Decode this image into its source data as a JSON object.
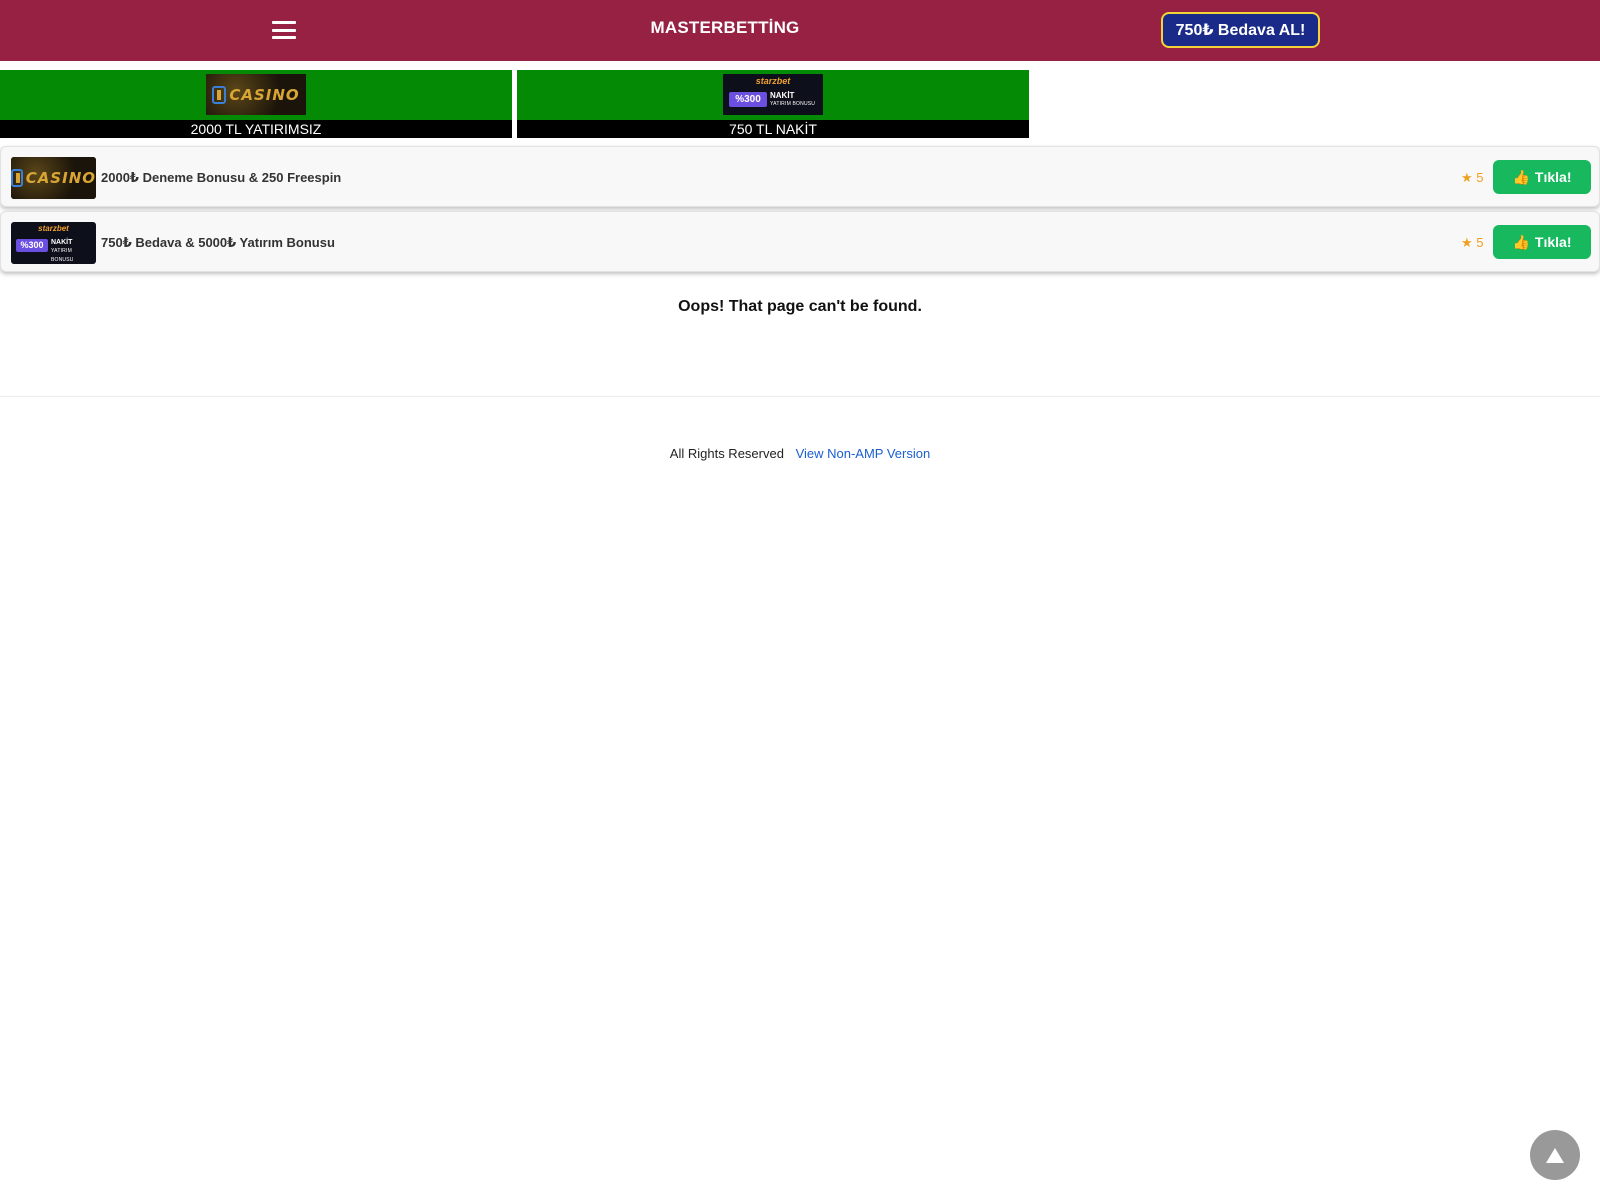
{
  "header": {
    "site_title": "MASTERBETTİNG",
    "cta_label": "750₺ Bedava AL!",
    "menu_icon": "hamburger-menu-icon"
  },
  "banners": [
    {
      "logo": "casino-logo",
      "logo_text": "CASINO",
      "caption": "2000 TL YATIRIMSIZ"
    },
    {
      "logo": "starzbet-logo",
      "logo_brand": "starzbet",
      "logo_percent": "%300",
      "logo_line1": "NAKİT",
      "logo_line2": "YATIRIM BONUSU",
      "caption": "750 TL NAKİT"
    }
  ],
  "offers": [
    {
      "logo": "casino-logo",
      "logo_text": "CASINO",
      "title": "2000₺ Deneme Bonusu & 250 Freespin",
      "rating": "★ 5",
      "button_label": "Tıkla!",
      "button_icon": "thumbs-up-icon"
    },
    {
      "logo": "starzbet-logo",
      "logo_brand": "starzbet",
      "logo_percent": "%300",
      "logo_line1": "NAKİT",
      "logo_line2": "YATIRIM BONUSU",
      "title": "750₺ Bedava & 5000₺ Yatırım Bonusu",
      "rating": "★ 5",
      "button_label": "Tıkla!",
      "button_icon": "thumbs-up-icon"
    }
  ],
  "main": {
    "message": "Oops! That page can't be found."
  },
  "footer": {
    "rights": "All Rights Reserved",
    "link_label": "View Non-AMP Version"
  },
  "colors": {
    "header_bg": "#962142",
    "cta_bg": "#1a2a88",
    "cta_border": "#f3d33a",
    "banner_bg": "#058a05",
    "button_green": "#17b85e",
    "rating": "#f0a020",
    "link": "#1a5fd0"
  },
  "back_to_top_icon": "arrow-up-icon"
}
